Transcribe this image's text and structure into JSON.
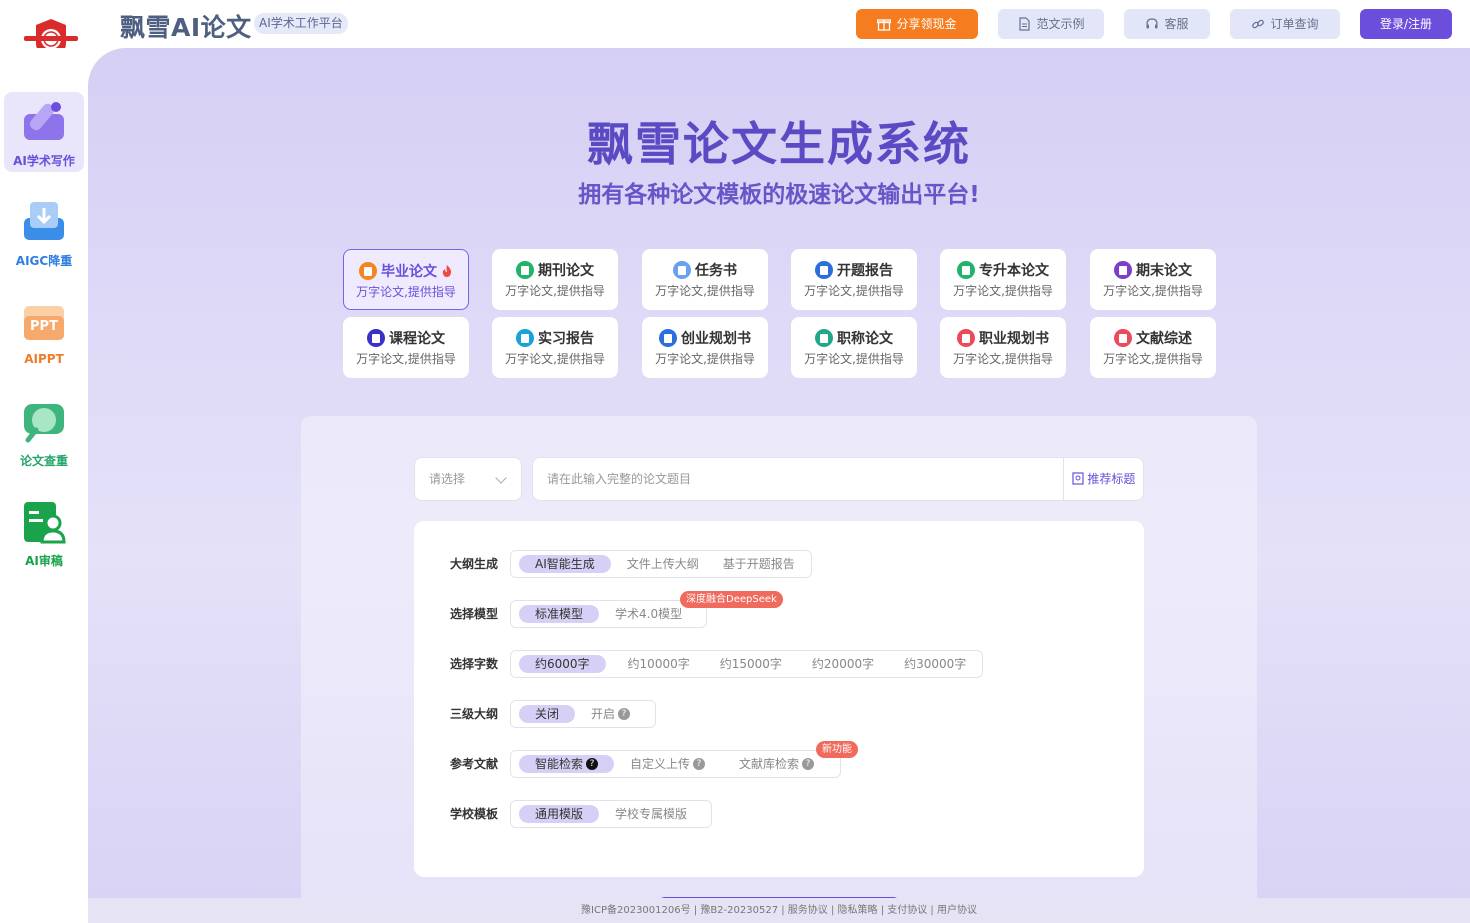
{
  "header": {
    "brand": "飘雪AI论文",
    "badge": "AI学术工作平台",
    "buttons": {
      "share": "分享领现金",
      "sample": "范文示例",
      "service": "客服",
      "order": "订单查询",
      "login": "登录/注册"
    }
  },
  "sidebar": {
    "items": [
      {
        "label": "AI学术写作",
        "color": "#6b4fdc",
        "icon": "pen-icon"
      },
      {
        "label": "AIGC降重",
        "color": "#2f7fe0",
        "icon": "download-tray-icon"
      },
      {
        "label": "AIPPT",
        "color": "#f07c2a",
        "icon": "ppt-icon"
      },
      {
        "label": "论文查重",
        "color": "#25a66a",
        "icon": "magnifier-chat-icon"
      },
      {
        "label": "AI审稿",
        "color": "#1aa34a",
        "icon": "reviewer-icon"
      }
    ]
  },
  "hero": {
    "title": "飘雪论文生成系统",
    "subtitle": "拥有各种论文模板的极速论文输出平台!"
  },
  "templates": [
    {
      "name": "毕业论文",
      "desc": "万字论文,提供指导",
      "color": "#f5851f",
      "hot": true
    },
    {
      "name": "期刊论文",
      "desc": "万字论文,提供指导",
      "color": "#21b36b"
    },
    {
      "name": "任务书",
      "desc": "万字论文,提供指导",
      "color": "#6aa0f0"
    },
    {
      "name": "开题报告",
      "desc": "万字论文,提供指导",
      "color": "#2b6fdc"
    },
    {
      "name": "专升本论文",
      "desc": "万字论文,提供指导",
      "color": "#21b36b"
    },
    {
      "name": "期末论文",
      "desc": "万字论文,提供指导",
      "color": "#7b3fc9"
    },
    {
      "name": "课程论文",
      "desc": "万字论文,提供指导",
      "color": "#3b2fc9"
    },
    {
      "name": "实习报告",
      "desc": "万字论文,提供指导",
      "color": "#1aa2d8"
    },
    {
      "name": "创业规划书",
      "desc": "万字论文,提供指导",
      "color": "#2b6fdc"
    },
    {
      "name": "职称论文",
      "desc": "万字论文,提供指导",
      "color": "#21a88a"
    },
    {
      "name": "职业规划书",
      "desc": "万字论文,提供指导",
      "color": "#ec4a5a"
    },
    {
      "name": "文献综述",
      "desc": "万字论文,提供指导",
      "color": "#ec4a5a"
    }
  ],
  "form": {
    "select_placeholder": "请选择",
    "topic_placeholder": "请在此输入完整的论文题目",
    "recommend": "推荐标题",
    "rows": {
      "outline": {
        "label": "大纲生成",
        "options": [
          "AI智能生成",
          "文件上传大纲",
          "基于开题报告"
        ]
      },
      "model": {
        "label": "选择模型",
        "options": [
          "标准模型",
          "学术4.0模型"
        ],
        "tag": "深度融合DeepSeek"
      },
      "words": {
        "label": "选择字数",
        "options": [
          "约6000字",
          "约10000字",
          "约15000字",
          "约20000字",
          "约30000字"
        ]
      },
      "level3": {
        "label": "三级大纲",
        "options": [
          "关闭",
          "开启"
        ]
      },
      "refs": {
        "label": "参考文献",
        "options": [
          "智能检索",
          "自定义上传",
          "文献库检索"
        ],
        "tag": "新功能"
      },
      "school": {
        "label": "学校模板",
        "options": [
          "通用模版",
          "学校专属模版"
        ]
      }
    }
  },
  "footer": {
    "text": "豫ICP备2023001206号 | 豫B2-20230527 | 服务协议 | 隐私策略 | 支付协议 | 用户协议"
  }
}
